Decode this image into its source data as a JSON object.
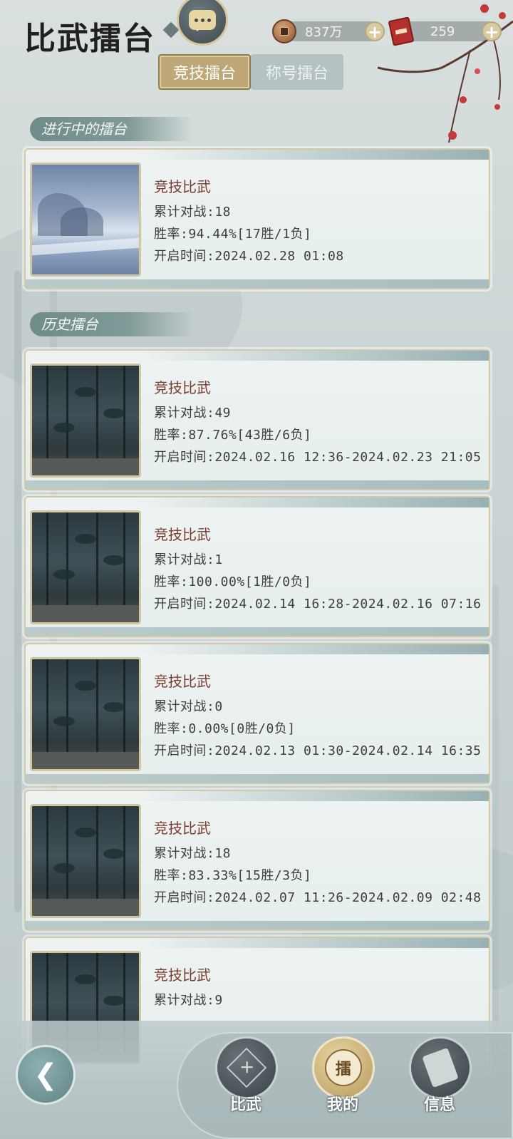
{
  "header": {
    "title": "比武擂台",
    "coins": "837万",
    "tickets": "259"
  },
  "tabs": [
    {
      "label": "竞技擂台",
      "active": true
    },
    {
      "label": "称号擂台",
      "active": false
    }
  ],
  "sections": {
    "ongoing": "进行中的擂台",
    "history": "历史擂台"
  },
  "ongoing_card": {
    "name": "竞技比武",
    "battles": "累计对战:18",
    "winrate": "胜率:94.44%[17胜/1负]",
    "time": "开启时间:2024.02.28 01:08"
  },
  "history_cards": [
    {
      "name": "竞技比武",
      "battles": "累计对战:49",
      "winrate": "胜率:87.76%[43胜/6负]",
      "time": "开启时间:2024.02.16 12:36-2024.02.23 21:05"
    },
    {
      "name": "竞技比武",
      "battles": "累计对战:1",
      "winrate": "胜率:100.00%[1胜/0负]",
      "time": "开启时间:2024.02.14 16:28-2024.02.16 07:16"
    },
    {
      "name": "竞技比武",
      "battles": "累计对战:0",
      "winrate": "胜率:0.00%[0胜/0负]",
      "time": "开启时间:2024.02.13 01:30-2024.02.14 16:35"
    },
    {
      "name": "竞技比武",
      "battles": "累计对战:18",
      "winrate": "胜率:83.33%[15胜/3负]",
      "time": "开启时间:2024.02.07 11:26-2024.02.09 02:48"
    },
    {
      "name": "竞技比武",
      "battles": "累计对战:9"
    }
  ],
  "nav": {
    "biwu": "比武",
    "wode": "我的",
    "wode_badge": "擂",
    "xinxi": "信息"
  },
  "colors": {
    "accent_gold": "#bfa877",
    "name_text": "#7a3c2c",
    "section_label": "#6f8c8a"
  }
}
